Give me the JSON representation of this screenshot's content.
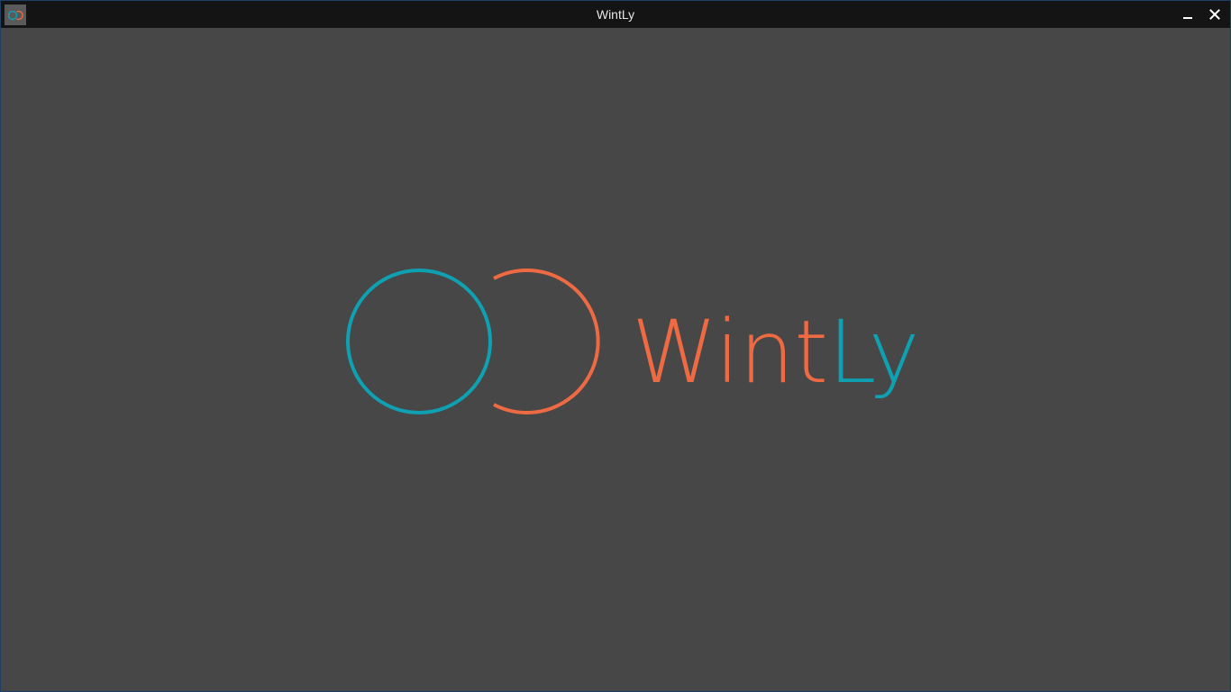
{
  "window": {
    "title": "WintLy"
  },
  "logo": {
    "wordmark_part1": "Wint",
    "wordmark_part2": "Ly",
    "colors": {
      "orange": "#ed6a43",
      "teal": "#0fa0b2"
    }
  },
  "controls": {
    "minimize_icon": "minimize-icon",
    "close_icon": "close-icon"
  }
}
